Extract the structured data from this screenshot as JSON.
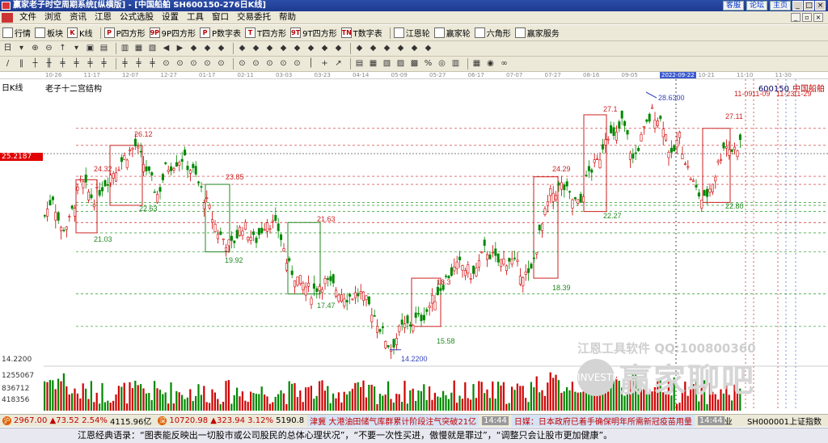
{
  "window": {
    "title": "赢家老子时空周期系统[纵横版] - [中国船舶  SH600150-276日K线]",
    "links": [
      "客服",
      "论坛",
      "主页"
    ],
    "buttons": [
      "_",
      "□",
      "×"
    ]
  },
  "menu": [
    "文件",
    "浏览",
    "资讯",
    "江恩",
    "公式选股",
    "设置",
    "工具",
    "窗口",
    "交易委托",
    "帮助"
  ],
  "toolbar1": [
    {
      "icon": "grid",
      "label": "行情"
    },
    {
      "icon": "block",
      "label": "板块"
    },
    {
      "icon": "K",
      "label": "K线"
    },
    {
      "icon": "P",
      "label": "P四方形"
    },
    {
      "icon": "9P",
      "label": "9P四方形"
    },
    {
      "icon": "P",
      "label": "P数字表"
    },
    {
      "icon": "T",
      "label": "T四方形"
    },
    {
      "icon": "9T",
      "label": "9T四方形"
    },
    {
      "icon": "TN",
      "label": "T数字表"
    },
    {
      "icon": "wheel",
      "label": "江恩轮"
    },
    {
      "icon": "wheel",
      "label": "赢家轮"
    },
    {
      "icon": "hex",
      "label": "六角形"
    },
    {
      "icon": "service",
      "label": "赢家服务"
    }
  ],
  "toolbar2_icons": [
    "日",
    "▾",
    "⊕",
    "⊖",
    "↑",
    "▾",
    "▣",
    "▤",
    "▥",
    "▦",
    "▧",
    "◀",
    "▶",
    "◆",
    "◆",
    "◆",
    "◆",
    "◆",
    "◆",
    "◆",
    "◆",
    "◆",
    "◆",
    "◆",
    "◆",
    "◆",
    "◆",
    "◆",
    "◆",
    "◆"
  ],
  "toolbar3_icons": [
    "/",
    "‖",
    "┼",
    "╫",
    "╪",
    "╪",
    "╪",
    "╪",
    "╪",
    "╪",
    "╪",
    "⊙",
    "⊙",
    "⊙",
    "⊙",
    "⊙",
    "⊙",
    "⊙",
    "⊙",
    "⊙",
    "⊙",
    "│",
    "+",
    "↗",
    "▤",
    "▦",
    "▧",
    "▨",
    "▩",
    "%",
    "◎",
    "▥",
    "▦",
    "◉",
    "∞"
  ],
  "date_axis": {
    "labels": [
      "10-26",
      "11-17",
      "12-07",
      "12-27",
      "01-17",
      "02-11",
      "03-03",
      "03-23",
      "04-14",
      "05-09",
      "05-27",
      "06-17",
      "07-07",
      "07-27",
      "08-16",
      "09-05",
      "2022-09-22",
      "10-21",
      "11-10",
      "11-30"
    ],
    "highlight": "2022-09-22"
  },
  "chart": {
    "period_label": "日K线",
    "indicator_name": "老子十二宫结构",
    "stock_code": "600150",
    "stock_name": "中国船舶",
    "current_price_flag": "25.2187",
    "axis_low_label": "14.2200",
    "dates": {
      "d1": "11-09",
      "d2": "11-09",
      "d3": "11-23",
      "d4": "11-29"
    },
    "box_labels": [
      "26.12",
      "24.32",
      "22.63",
      "21.03",
      "23.85",
      "19.92",
      "21.63",
      "17.47",
      "15.58",
      "18.39",
      "24.29",
      "22.27",
      "27.11",
      "22.80",
      "27.1",
      "14.2200",
      "28.6300",
      "18.3"
    ],
    "volume_labels": [
      "1255067",
      "836712",
      "418356"
    ]
  },
  "watermark": {
    "line1": "江恩工具软件  QQ:100800360",
    "brand": "赢家聊吧",
    "logo": "INVESTM"
  },
  "ticker": {
    "sh_index": "2967.00",
    "sh_change": "▲73.52",
    "sh_pct": "2.54%",
    "sh_amount": "4115.96亿",
    "sz_index": "10720.98",
    "sz_change": "▲323.94",
    "sz_pct": "3.12%",
    "sz_amount": "5190.8",
    "news1_prefix": "津冀",
    "news1": "大港油田储气库群累计阶段注气突破21亿",
    "news1_time": "14:44",
    "news2": "日媒：日本政府已着手确保明年所需新冠疫苗用量",
    "news2_time": "14:44",
    "news2_tail": "业",
    "code": "SH000001上证指数"
  },
  "quote": "江恩经典语录：“图表能反映出一切股市或公司股民的总体心理状况”，“不要一次性买进，傲慢就是罪过”，“调整只会让股市更加健康”。"
}
